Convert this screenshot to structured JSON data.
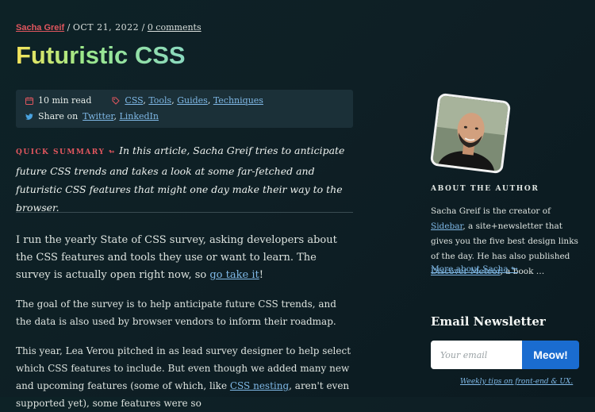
{
  "byline": {
    "author": "Sacha Greif",
    "separator": " / ",
    "date": "Oct 21, 2022",
    "separator2": " / ",
    "comments": "0 comments"
  },
  "article": {
    "title": "Futuristic CSS",
    "meta": {
      "read_time": "10 min read",
      "tags": [
        "CSS",
        "Tools",
        "Guides",
        "Techniques"
      ],
      "share_prefix": "Share on",
      "share_links": [
        "Twitter",
        "LinkedIn"
      ]
    },
    "summary": {
      "label": "QUICK SUMMARY ↬",
      "text": "In this article, Sacha Greif tries to anticipate future CSS trends and takes a look at some far-fetched and futuristic CSS features that might one day make their way to the browser."
    },
    "p1": {
      "text": "I run the yearly State of CSS survey, asking developers about the CSS features and tools they use or want to learn. The survey is actually open right now, so ",
      "link": "go take it",
      "end": "!"
    },
    "p2": {
      "text": "The goal of the survey is to help anticipate future CSS trends, and the data is also used by browser vendors to inform their roadmap."
    },
    "p3": {
      "text": "This year, Lea Verou pitched in as lead survey designer to help select which CSS features to include. But even though we added many new and upcoming features (some of which, like ",
      "link": "CSS nesting",
      "end": ", aren't even supported yet), some features were so"
    }
  },
  "sidebar": {
    "about_title": "ABOUT THE AUTHOR",
    "about": {
      "t1": "Sacha Greif is the creator of ",
      "l1": "Sidebar",
      "t2": ", a site+newsletter that gives you the five best design links of the day. He has also published ",
      "l2": "Discover Meteor",
      "t3": ", a book …"
    },
    "more": "More about Sacha ↬",
    "newsletter": {
      "title": "Email Newsletter",
      "placeholder": "Your email",
      "button": "Meow!",
      "tips": "Weekly tips on front-end & UX."
    }
  },
  "colors": {
    "accent_red": "#e0565e",
    "link": "#7fb8e6",
    "button": "#1a6cd0",
    "background": "#0d2226"
  },
  "icons": [
    "calendar-icon",
    "tag-icon",
    "twitter-icon"
  ]
}
